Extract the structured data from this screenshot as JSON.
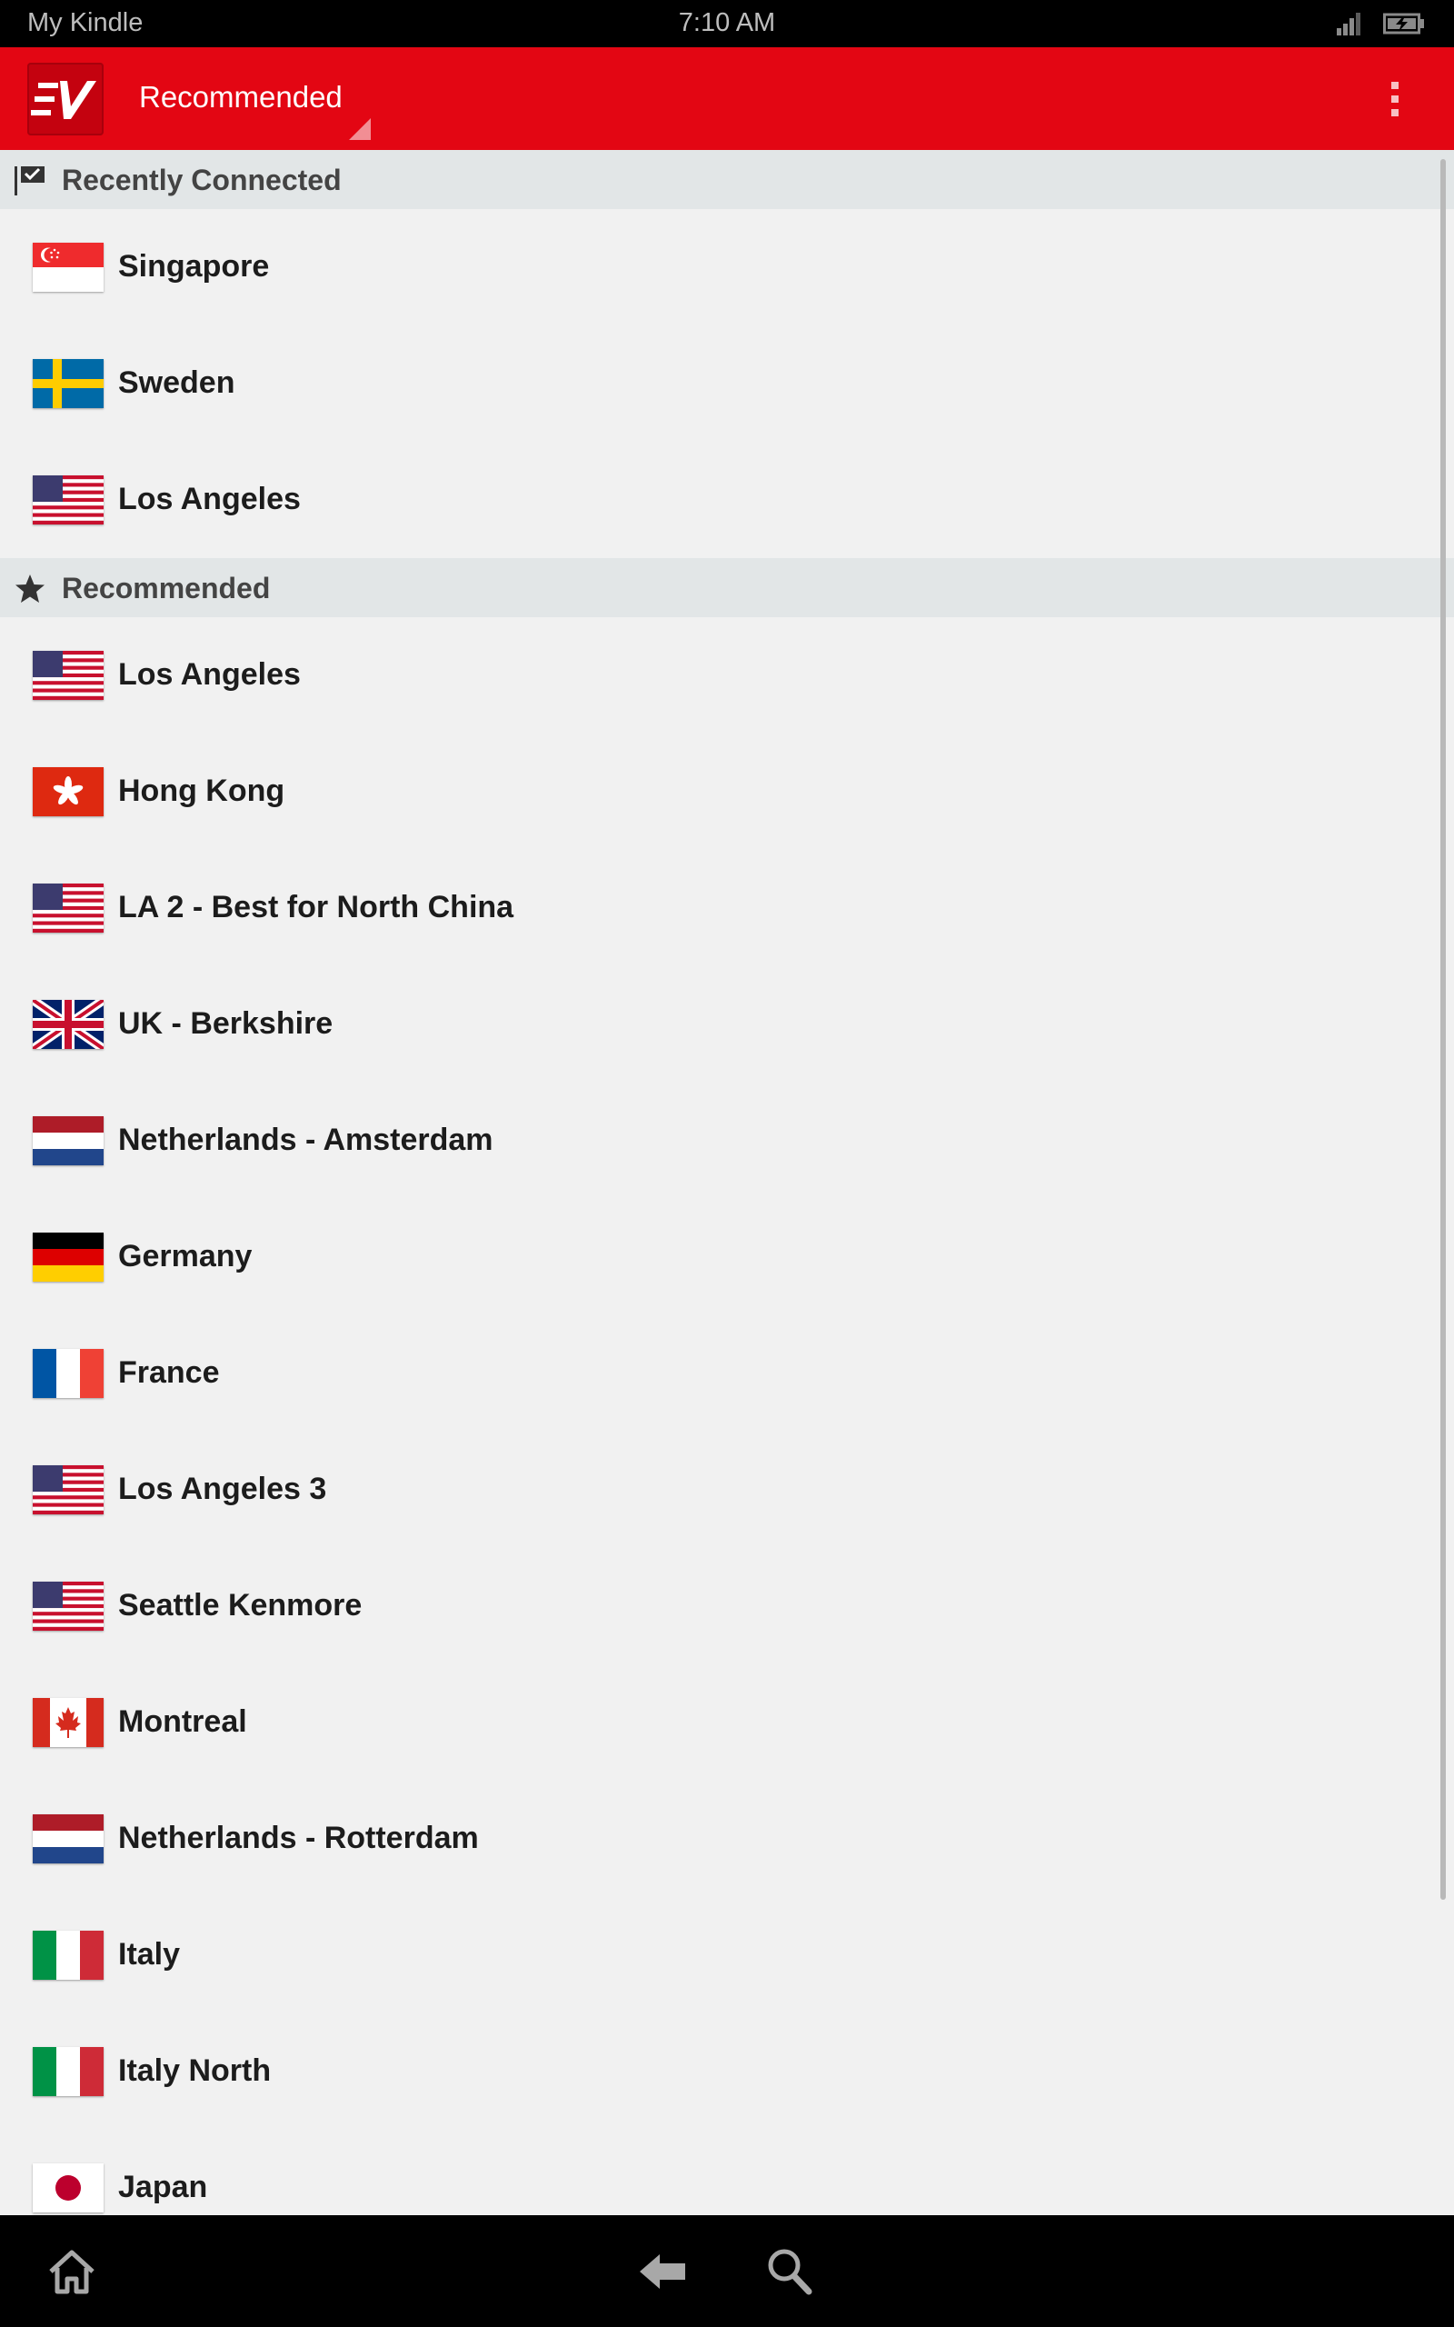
{
  "status_bar": {
    "device_name": "My Kindle",
    "time": "7:10 AM",
    "signal_icon": "signal-icon",
    "battery_icon": "battery-charging-icon"
  },
  "app_bar": {
    "logo_icon": "expressvpn-logo-icon",
    "title": "Recommended",
    "menu_icon": "overflow-menu-icon",
    "color": "#e30613"
  },
  "sections": [
    {
      "header": "Recently Connected",
      "icon": "flag-check-icon",
      "items": [
        {
          "label": "Singapore",
          "flag": "sg"
        },
        {
          "label": "Sweden",
          "flag": "se"
        },
        {
          "label": "Los Angeles",
          "flag": "us"
        }
      ]
    },
    {
      "header": "Recommended",
      "icon": "star-icon",
      "items": [
        {
          "label": "Los Angeles",
          "flag": "us"
        },
        {
          "label": "Hong Kong",
          "flag": "hk"
        },
        {
          "label": "LA 2 - Best for North China",
          "flag": "us"
        },
        {
          "label": "UK - Berkshire",
          "flag": "gb"
        },
        {
          "label": "Netherlands - Amsterdam",
          "flag": "nl"
        },
        {
          "label": "Germany",
          "flag": "de"
        },
        {
          "label": "France",
          "flag": "fr"
        },
        {
          "label": "Los Angeles 3",
          "flag": "us"
        },
        {
          "label": "Seattle Kenmore",
          "flag": "us"
        },
        {
          "label": "Montreal",
          "flag": "ca"
        },
        {
          "label": "Netherlands - Rotterdam",
          "flag": "nl"
        },
        {
          "label": "Italy",
          "flag": "it"
        },
        {
          "label": "Italy North",
          "flag": "it"
        },
        {
          "label": "Japan",
          "flag": "jp"
        }
      ]
    }
  ],
  "nav_bar": {
    "icons": [
      "home-icon",
      "back-icon",
      "search-icon"
    ]
  }
}
